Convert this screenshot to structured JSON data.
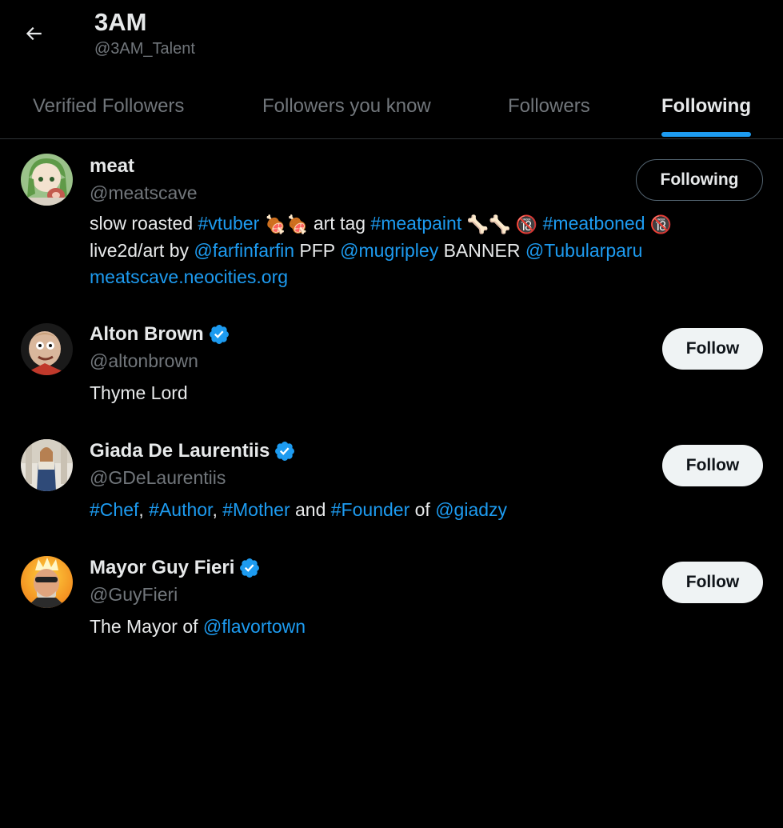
{
  "header": {
    "title": "3AM",
    "handle": "@3AM_Talent"
  },
  "tabs": [
    {
      "label": "Verified Followers",
      "active": false
    },
    {
      "label": "Followers you know",
      "active": false
    },
    {
      "label": "Followers",
      "active": false
    },
    {
      "label": "Following",
      "active": true
    }
  ],
  "users": [
    {
      "name": "meat",
      "handle": "@meatscave",
      "verified": false,
      "button": "Following",
      "bio": {
        "t1": "slow roasted ",
        "l1": "#vtuber",
        "t2": " art tag ",
        "l2": "#meatpaint",
        "l3": "#meatboned",
        "t3": "live2d/art by ",
        "l4": "@farfinfarfin",
        "t4": " PFP ",
        "l5": "@mugripley",
        "t5": " BANNER ",
        "l6": "@Tubularparu",
        "l7": "meatscave.neocities.org"
      }
    },
    {
      "name": "Alton Brown",
      "handle": "@altonbrown",
      "verified": true,
      "button": "Follow",
      "bio": {
        "t1": "Thyme Lord"
      }
    },
    {
      "name": "Giada De Laurentiis",
      "handle": "@GDeLaurentiis",
      "verified": true,
      "button": "Follow",
      "bio": {
        "l1": "#Chef",
        "t1": ", ",
        "l2": "#Author",
        "t2": ", ",
        "l3": "#Mother",
        "t3": " and ",
        "l4": "#Founder",
        "t4": " of ",
        "l5": "@giadzy"
      }
    },
    {
      "name": "Mayor Guy Fieri",
      "handle": "@GuyFieri",
      "verified": true,
      "button": "Follow",
      "bio": {
        "t1": "The Mayor of ",
        "l1": "@flavortown"
      }
    }
  ],
  "colors": {
    "background": "#000000",
    "accent": "#1d9bf0",
    "text_primary": "#e7e9ea",
    "text_secondary": "#71767b"
  },
  "icons": {
    "back": "back-arrow-icon",
    "verified": "verified-badge-icon",
    "meat_emoji": "meat-on-bone-emoji",
    "bone_emoji": "bone-emoji",
    "no_under_18": "no-one-under-eighteen-emoji"
  }
}
